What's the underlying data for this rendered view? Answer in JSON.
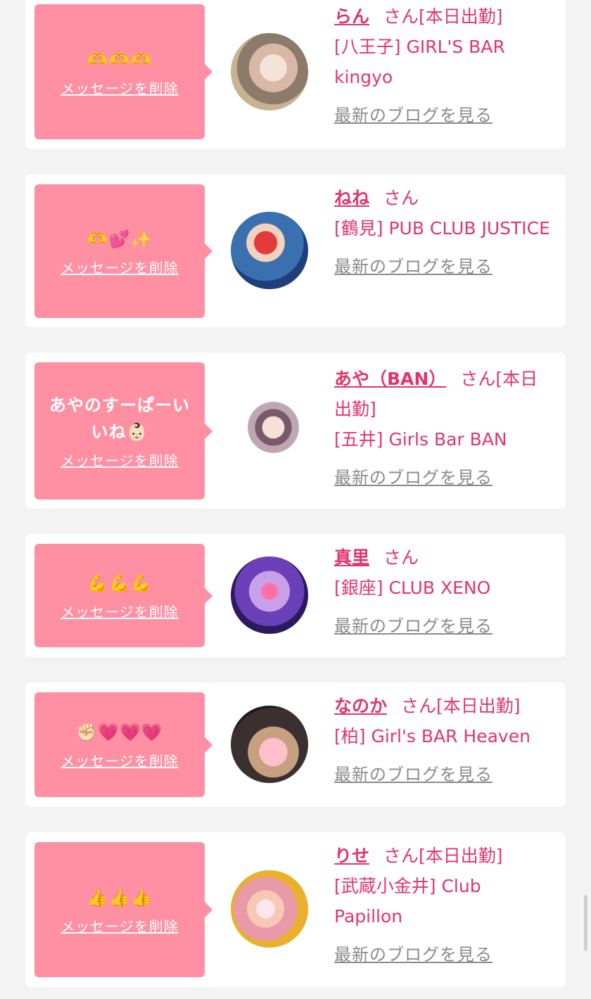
{
  "colors": {
    "accent": "#e2356d",
    "bubble": "#ff8fa3",
    "link_gray": "#8a8a8a",
    "bg": "#f3f3f3"
  },
  "delete_label": "メッセージを削除",
  "blog_label": "最新のブログを見る",
  "san_label": "さん",
  "items": [
    {
      "message": "🫶🫶🫶",
      "name": "らん",
      "status": "[本日出勤]",
      "shop": "[八王子] GIRL'S BAR kingyo"
    },
    {
      "message": "🫶💕✨",
      "name": "ねね",
      "status": "",
      "shop": "[鶴見] PUB CLUB JUSTICE"
    },
    {
      "message": "あやのすーぱーいいね👶🏻",
      "name": "あや（BAN）",
      "status": "[本日出勤]",
      "shop": "[五井] Girls Bar BAN"
    },
    {
      "message": "💪💪💪",
      "name": "真里",
      "status": "",
      "shop": "[銀座] CLUB XENO"
    },
    {
      "message": "✊🏻💗💗💗",
      "name": "なのか",
      "status": "[本日出勤]",
      "shop": "[柏] Girl's BAR Heaven"
    },
    {
      "message": "👍👍👍",
      "name": "りせ",
      "status": "[本日出勤]",
      "shop": "[武蔵小金井] Club Papillon"
    }
  ]
}
